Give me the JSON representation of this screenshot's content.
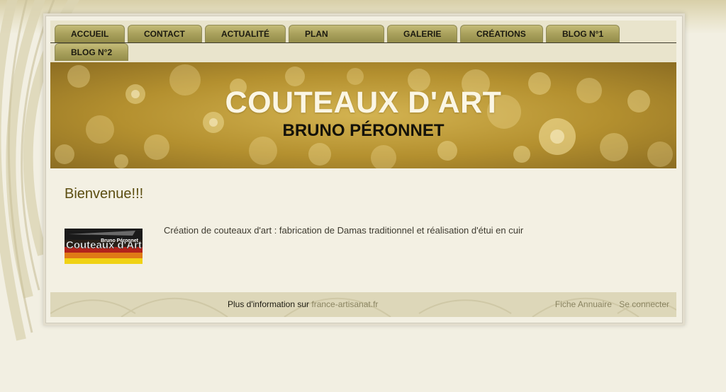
{
  "nav": {
    "items": [
      {
        "label": "ACCUEIL"
      },
      {
        "label": "CONTACT"
      },
      {
        "label": "ACTUALITÉ"
      },
      {
        "label": "PLAN"
      },
      {
        "label": "GALERIE"
      },
      {
        "label": "CRÉATIONS"
      },
      {
        "label": "BLOG N°1"
      },
      {
        "label": "BLOG N°2"
      }
    ]
  },
  "header": {
    "title": "COUTEAUX D'ART",
    "subtitle": "BRUNO PÉRONNET"
  },
  "main": {
    "heading": "Bienvenue!!!",
    "logo_text": "Couteaux d'Art",
    "logo_caption": "Bruno Péronnet",
    "intro": "Création de couteaux d'art : fabrication de Damas traditionnel et réalisation d'étui en cuir"
  },
  "footer": {
    "info_prefix": "Plus d'information sur",
    "info_link": "france-artisanat.fr",
    "links": [
      {
        "label": "Fiche Annuaire"
      },
      {
        "label": "Se connecter"
      }
    ]
  },
  "colors": {
    "accent_gold": "#b4902f",
    "tab_olive": "#a9a15c",
    "heading_brown": "#5b4d10",
    "background": "#f2efe2"
  }
}
